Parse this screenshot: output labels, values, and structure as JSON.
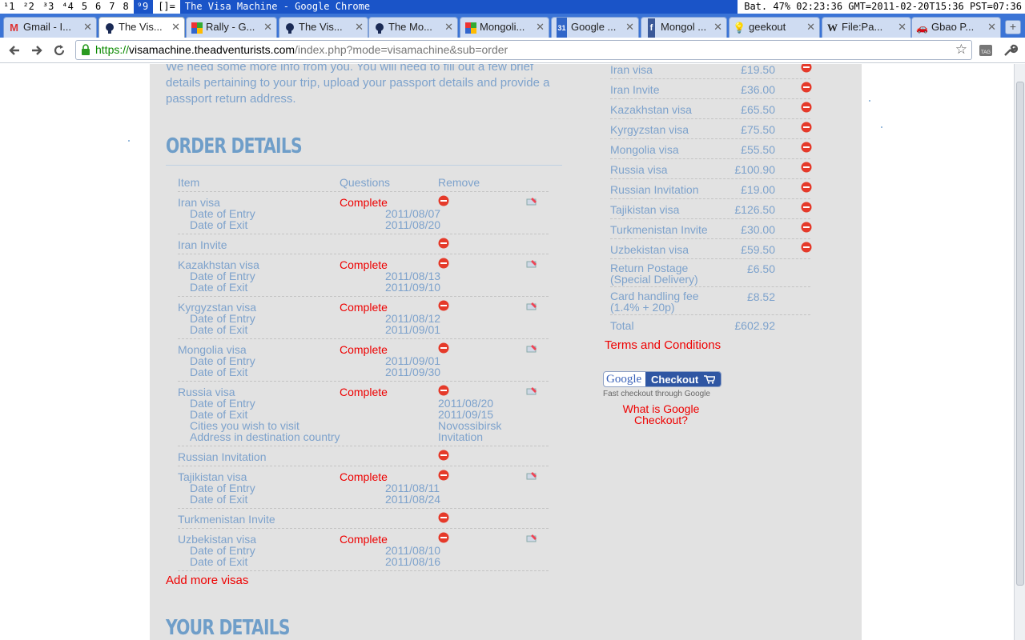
{
  "wm": {
    "tags": [
      "¹1",
      "²2",
      "³3",
      "⁴4",
      "5",
      "6",
      "7",
      "8",
      "⁹9"
    ],
    "active_tag_index": 8,
    "layout": "[]=",
    "title": "The Visa Machine - Google Chrome",
    "status": "Bat. 47% 02:23:36  GMT=2011-02-20T15:36 PST=07:36"
  },
  "tabs": [
    {
      "label": "Gmail - I...",
      "icon": "gmail-icon"
    },
    {
      "label": "The Vis...",
      "icon": "adventurists-icon",
      "active": true
    },
    {
      "label": "Rally - G...",
      "icon": "google-maps-icon"
    },
    {
      "label": "The Vis...",
      "icon": "adventurists-icon"
    },
    {
      "label": "The Mo...",
      "icon": "adventurists-icon"
    },
    {
      "label": "Mongoli...",
      "icon": "google-maps-icon"
    },
    {
      "label": "Google ...",
      "icon": "google-calendar-icon"
    },
    {
      "label": "Mongol ...",
      "icon": "facebook-icon"
    },
    {
      "label": "geekout",
      "icon": "lightbulb-icon"
    },
    {
      "label": "File:Pa...",
      "icon": "wikipedia-icon"
    },
    {
      "label": "Gbao P...",
      "icon": "car-icon"
    }
  ],
  "toolbar": {
    "url_scheme": "https://",
    "url_host": "visamachine.theadventurists.com",
    "url_path": "/index.php?mode=visamachine&sub=order"
  },
  "page": {
    "intro": "We need some more info from you. You will need to fill out a few brief details pertaining to your trip, upload your passport details and provide a passport return address.",
    "order_heading": "ORDER DETAILS",
    "details_heading": "YOUR DETAILS",
    "columns": {
      "item": "Item",
      "questions": "Questions",
      "remove": "Remove"
    },
    "orders": [
      {
        "name": "Iran visa",
        "status": "Complete",
        "editable": true,
        "details": [
          {
            "label": "Date of Entry",
            "value": "2011/08/07"
          },
          {
            "label": "Date of Exit",
            "value": "2011/08/20"
          }
        ]
      },
      {
        "name": "Iran Invite",
        "status": "",
        "editable": false,
        "details": []
      },
      {
        "name": "Kazakhstan visa",
        "status": "Complete",
        "editable": true,
        "details": [
          {
            "label": "Date of Entry",
            "value": "2011/08/13"
          },
          {
            "label": "Date of Exit",
            "value": "2011/09/10"
          }
        ]
      },
      {
        "name": "Kyrgyzstan visa",
        "status": "Complete",
        "editable": true,
        "details": [
          {
            "label": "Date of Entry",
            "value": "2011/08/12"
          },
          {
            "label": "Date of Exit",
            "value": "2011/09/01"
          }
        ]
      },
      {
        "name": "Mongolia visa",
        "status": "Complete",
        "editable": true,
        "details": [
          {
            "label": "Date of Entry",
            "value": "2011/09/01"
          },
          {
            "label": "Date of Exit",
            "value": "2011/09/30"
          }
        ]
      },
      {
        "name": "Russia visa",
        "status": "Complete",
        "editable": true,
        "wide": true,
        "details": [
          {
            "label": "Date of Entry",
            "value": "2011/08/20"
          },
          {
            "label": "Date of Exit",
            "value": "2011/09/15"
          },
          {
            "label": "Cities you wish to visit",
            "value": "Novossibirsk"
          },
          {
            "label": "Address in destination country",
            "value": "Invitation"
          }
        ]
      },
      {
        "name": "Russian Invitation",
        "status": "",
        "editable": false,
        "details": []
      },
      {
        "name": "Tajikistan visa",
        "status": "Complete",
        "editable": true,
        "details": [
          {
            "label": "Date of Entry",
            "value": "2011/08/11"
          },
          {
            "label": "Date of Exit",
            "value": "2011/08/24"
          }
        ]
      },
      {
        "name": "Turkmenistan Invite",
        "status": "",
        "editable": false,
        "details": []
      },
      {
        "name": "Uzbekistan visa",
        "status": "Complete",
        "editable": true,
        "details": [
          {
            "label": "Date of Entry",
            "value": "2011/08/10"
          },
          {
            "label": "Date of Exit",
            "value": "2011/08/16"
          }
        ]
      }
    ],
    "add_more": "Add more visas",
    "summary": [
      {
        "name": "Iran visa",
        "price": "£19.50"
      },
      {
        "name": "Iran Invite",
        "price": "£36.00"
      },
      {
        "name": "Kazakhstan visa",
        "price": "£65.50"
      },
      {
        "name": "Kyrgyzstan visa",
        "price": "£75.50"
      },
      {
        "name": "Mongolia visa",
        "price": "£55.50"
      },
      {
        "name": "Russia visa",
        "price": "£100.90"
      },
      {
        "name": "Russian Invitation",
        "price": "£19.00"
      },
      {
        "name": "Tajikistan visa",
        "price": "£126.50"
      },
      {
        "name": "Turkmenistan Invite",
        "price": "£30.00"
      },
      {
        "name": "Uzbekistan visa",
        "price": "£59.50"
      }
    ],
    "fees": [
      {
        "name_line1": "Return Postage",
        "name_line2": "(Special Delivery)",
        "price": "£6.50"
      },
      {
        "name_line1": "Card handling fee",
        "name_line2": "(1.4% + 20p)",
        "price": "£8.52"
      }
    ],
    "total_label": "Total",
    "total": "£602.92",
    "terms": "Terms and Conditions",
    "gcheckout_google": "Google",
    "gcheckout_label": "Checkout",
    "fast_checkout": "Fast checkout through Google",
    "what_is": "What is Google Checkout?"
  },
  "colors": {
    "accent_blue": "#6f9ac8",
    "link_red": "#ee0000",
    "wm_blue": "#1a54c8",
    "content_bg": "#e2e2e2"
  }
}
